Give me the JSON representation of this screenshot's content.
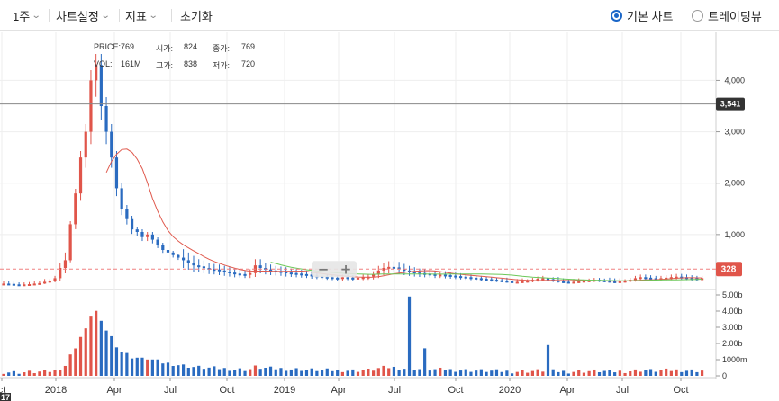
{
  "toolbar": {
    "period": "1주",
    "chart_settings": "차트설정",
    "indicators": "지표",
    "reset": "초기화",
    "basic_chart": "기본 차트",
    "trading_view": "트레이딩뷰"
  },
  "info": {
    "price_label": "PRICE:",
    "price": "769",
    "vol_label": "VOL:",
    "vol": "161M",
    "open_label": "시가:",
    "open": "824",
    "high_label": "고가:",
    "high": "838",
    "close_label": "종가:",
    "close": "769",
    "low_label": "저가:",
    "low": "720"
  },
  "badges": {
    "crosshair": "3,541",
    "current": "328",
    "bottom_left": "17"
  },
  "zoom": {
    "minus": "−",
    "plus": "+"
  },
  "colors": {
    "up": "#e0554a",
    "down": "#2a6bc0",
    "ma_red": "#e05a4e",
    "ma_green": "#6cc85a",
    "accent": "#1a66c8"
  },
  "chart_data": {
    "type": "candlestick",
    "x_ticks": [
      "ct",
      "2018",
      "Apr",
      "Jul",
      "Oct",
      "2019",
      "Apr",
      "Jul",
      "Oct",
      "2020",
      "Apr",
      "Jul",
      "Oct"
    ],
    "y_ticks": [
      "4,000",
      "3,000",
      "2,000",
      "1,000"
    ],
    "ylim": [
      0,
      4900
    ],
    "volume_ticks": [
      "5.00b",
      "4.00b",
      "3.00b",
      "2.00b",
      "1000m",
      "0"
    ],
    "volume_ylim": [
      0,
      5000
    ],
    "price_series": [
      [
        0,
        3,
        45
      ],
      [
        2,
        3,
        40
      ],
      [
        4,
        3,
        30
      ],
      [
        6,
        3,
        25
      ],
      [
        7,
        4,
        30
      ],
      [
        8,
        4,
        35
      ],
      [
        9,
        5,
        45
      ],
      [
        10,
        5,
        55
      ],
      [
        11,
        5,
        80
      ],
      [
        12,
        6,
        100
      ],
      [
        13,
        6,
        150
      ],
      [
        14,
        6,
        350
      ],
      [
        15,
        7,
        500
      ],
      [
        16,
        7,
        1200
      ],
      [
        17,
        7,
        1800
      ],
      [
        18,
        8,
        2500
      ],
      [
        19,
        8,
        3000
      ],
      [
        20,
        9,
        4000
      ],
      [
        21,
        9,
        4300
      ],
      [
        22,
        9,
        3500
      ],
      [
        23,
        10,
        3000
      ],
      [
        24,
        10,
        2500
      ],
      [
        25,
        11,
        1900
      ],
      [
        26,
        11,
        1500
      ],
      [
        27,
        11,
        1300
      ],
      [
        28,
        12,
        1100
      ],
      [
        29,
        12,
        1050
      ],
      [
        30,
        13,
        950
      ],
      [
        31,
        13,
        1000
      ],
      [
        32,
        14,
        900
      ],
      [
        33,
        14,
        800
      ],
      [
        34,
        15,
        700
      ],
      [
        35,
        16,
        650
      ],
      [
        36,
        16,
        600
      ],
      [
        37,
        17,
        550
      ],
      [
        38,
        17,
        500
      ],
      [
        39,
        18,
        450
      ],
      [
        40,
        18,
        400
      ],
      [
        41,
        19,
        380
      ],
      [
        42,
        19,
        350
      ],
      [
        43,
        20,
        330
      ],
      [
        44,
        20,
        320
      ],
      [
        45,
        21,
        300
      ],
      [
        46,
        21,
        280
      ],
      [
        47,
        22,
        260
      ],
      [
        48,
        22,
        240
      ],
      [
        49,
        23,
        230
      ],
      [
        50,
        23,
        220
      ],
      [
        51,
        24,
        250
      ],
      [
        52,
        24,
        400
      ],
      [
        53,
        25,
        350
      ],
      [
        54,
        25,
        320
      ],
      [
        55,
        26,
        300
      ],
      [
        56,
        27,
        290
      ],
      [
        57,
        28,
        280
      ],
      [
        58,
        28,
        260
      ],
      [
        59,
        29,
        250
      ],
      [
        60,
        29,
        240
      ],
      [
        61,
        30,
        230
      ],
      [
        62,
        30,
        220
      ],
      [
        63,
        31,
        200
      ],
      [
        64,
        31,
        190
      ],
      [
        65,
        32,
        180
      ],
      [
        66,
        32,
        170
      ],
      [
        67,
        33,
        160
      ],
      [
        68,
        34,
        150
      ],
      [
        69,
        35,
        170
      ],
      [
        70,
        36,
        160
      ],
      [
        71,
        37,
        150
      ],
      [
        72,
        38,
        160
      ],
      [
        73,
        39,
        170
      ],
      [
        74,
        40,
        180
      ],
      [
        75,
        40,
        220
      ],
      [
        76,
        41,
        300
      ],
      [
        77,
        41,
        350
      ],
      [
        78,
        42,
        370
      ],
      [
        79,
        42,
        360
      ],
      [
        80,
        43,
        330
      ],
      [
        81,
        43,
        300
      ],
      [
        82,
        44,
        280
      ],
      [
        83,
        44,
        260
      ],
      [
        84,
        45,
        250
      ],
      [
        85,
        45,
        240
      ],
      [
        86,
        46,
        230
      ],
      [
        87,
        46,
        220
      ],
      [
        88,
        47,
        220
      ],
      [
        89,
        47,
        210
      ],
      [
        90,
        48,
        200
      ],
      [
        91,
        48,
        190
      ],
      [
        92,
        49,
        180
      ],
      [
        93,
        49,
        170
      ],
      [
        94,
        50,
        160
      ],
      [
        95,
        50,
        150
      ],
      [
        96,
        51,
        140
      ],
      [
        97,
        51,
        130
      ],
      [
        98,
        52,
        120
      ],
      [
        99,
        52,
        110
      ],
      [
        100,
        53,
        100
      ],
      [
        101,
        53,
        90
      ],
      [
        102,
        54,
        80
      ],
      [
        103,
        54,
        80
      ],
      [
        104,
        55,
        90
      ],
      [
        105,
        55,
        100
      ],
      [
        106,
        56,
        120
      ],
      [
        107,
        56,
        140
      ],
      [
        108,
        57,
        150
      ],
      [
        109,
        57,
        130
      ],
      [
        110,
        58,
        110
      ],
      [
        111,
        58,
        90
      ],
      [
        112,
        59,
        80
      ],
      [
        113,
        59,
        70
      ],
      [
        114,
        60,
        80
      ],
      [
        115,
        60,
        90
      ],
      [
        116,
        61,
        100
      ],
      [
        117,
        61,
        110
      ],
      [
        118,
        62,
        120
      ],
      [
        119,
        62,
        110
      ],
      [
        120,
        63,
        100
      ],
      [
        121,
        63,
        90
      ],
      [
        122,
        64,
        80
      ],
      [
        123,
        64,
        90
      ],
      [
        124,
        65,
        100
      ],
      [
        125,
        65,
        120
      ],
      [
        126,
        66,
        150
      ],
      [
        127,
        66,
        170
      ],
      [
        128,
        67,
        160
      ],
      [
        129,
        67,
        150
      ],
      [
        130,
        68,
        140
      ],
      [
        131,
        68,
        150
      ],
      [
        132,
        69,
        160
      ],
      [
        133,
        69,
        170
      ],
      [
        134,
        70,
        180
      ],
      [
        135,
        70,
        170
      ],
      [
        136,
        71,
        160
      ],
      [
        137,
        71,
        150
      ],
      [
        138,
        72,
        140
      ],
      [
        139,
        73,
        150
      ]
    ]
  }
}
